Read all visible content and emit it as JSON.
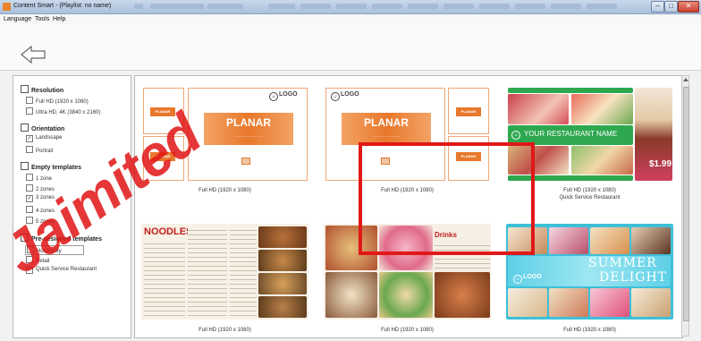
{
  "window": {
    "title": "Content Smart - (Playlist: no name)",
    "minimize_glyph": "–",
    "maximize_glyph": "□",
    "close_glyph": "✕"
  },
  "menu": {
    "items": [
      "Language",
      "Tools",
      "Help"
    ]
  },
  "toolbar": {
    "back_icon": "arrow-left-icon"
  },
  "filters": {
    "resolution": {
      "title": "Resolution",
      "options": [
        {
          "label": "Full HD (1920 x 1080)",
          "checked": false
        },
        {
          "label": "Ultra HD, 4K (3840 x 2160)",
          "checked": false
        }
      ]
    },
    "orientation": {
      "title": "Orientation",
      "options": [
        {
          "label": "Landscape",
          "checked": true
        },
        {
          "label": "Portrait",
          "checked": false
        }
      ]
    },
    "empty_templates": {
      "title": "Empty templates",
      "options": [
        {
          "label": "1 zone",
          "checked": false
        },
        {
          "label": "2 zones",
          "checked": false
        },
        {
          "label": "3 zones",
          "checked": true
        },
        {
          "label": "4 zones",
          "checked": false
        },
        {
          "label": "5 zones",
          "checked": false
        }
      ]
    },
    "predesigned": {
      "title": "Pre-designed templates",
      "options": [
        {
          "label": "Hospitality",
          "checked": false
        },
        {
          "label": "Retail",
          "checked": false
        },
        {
          "label": "Quick Service Restaurant",
          "checked": true
        }
      ]
    }
  },
  "templates": [
    {
      "caption": "Full HD (1920 x 1080)",
      "subcaption": "",
      "planar": "PLANAR",
      "logo": "LOGO"
    },
    {
      "caption": "Full HD (1920 x 1080)",
      "subcaption": "",
      "planar": "PLANAR",
      "logo": "LOGO"
    },
    {
      "caption": "Full HD (1920 x 1080)",
      "subcaption": "Quick Service Restaurant",
      "restaurant_name": "YOUR RESTAURANT NAME",
      "logo": "LOGO",
      "price": "$1.99"
    },
    {
      "caption": "Full HD (1920 x 1080)",
      "subcaption": "",
      "title": "NOODLES"
    },
    {
      "caption": "Full HD (1920 x 1080)",
      "subcaption": "",
      "title": "Drinks"
    },
    {
      "caption": "Full HD (1920 x 1080)",
      "subcaption": "",
      "promo_line1": "SUMMER",
      "promo_line2": "DELIGHT",
      "logo": "LOGO"
    }
  ],
  "colors": {
    "accent": "#e8782b",
    "selection": "#e01818",
    "green": "#2ea84f",
    "teal": "#38b8d0"
  },
  "watermark": "Jaimited"
}
